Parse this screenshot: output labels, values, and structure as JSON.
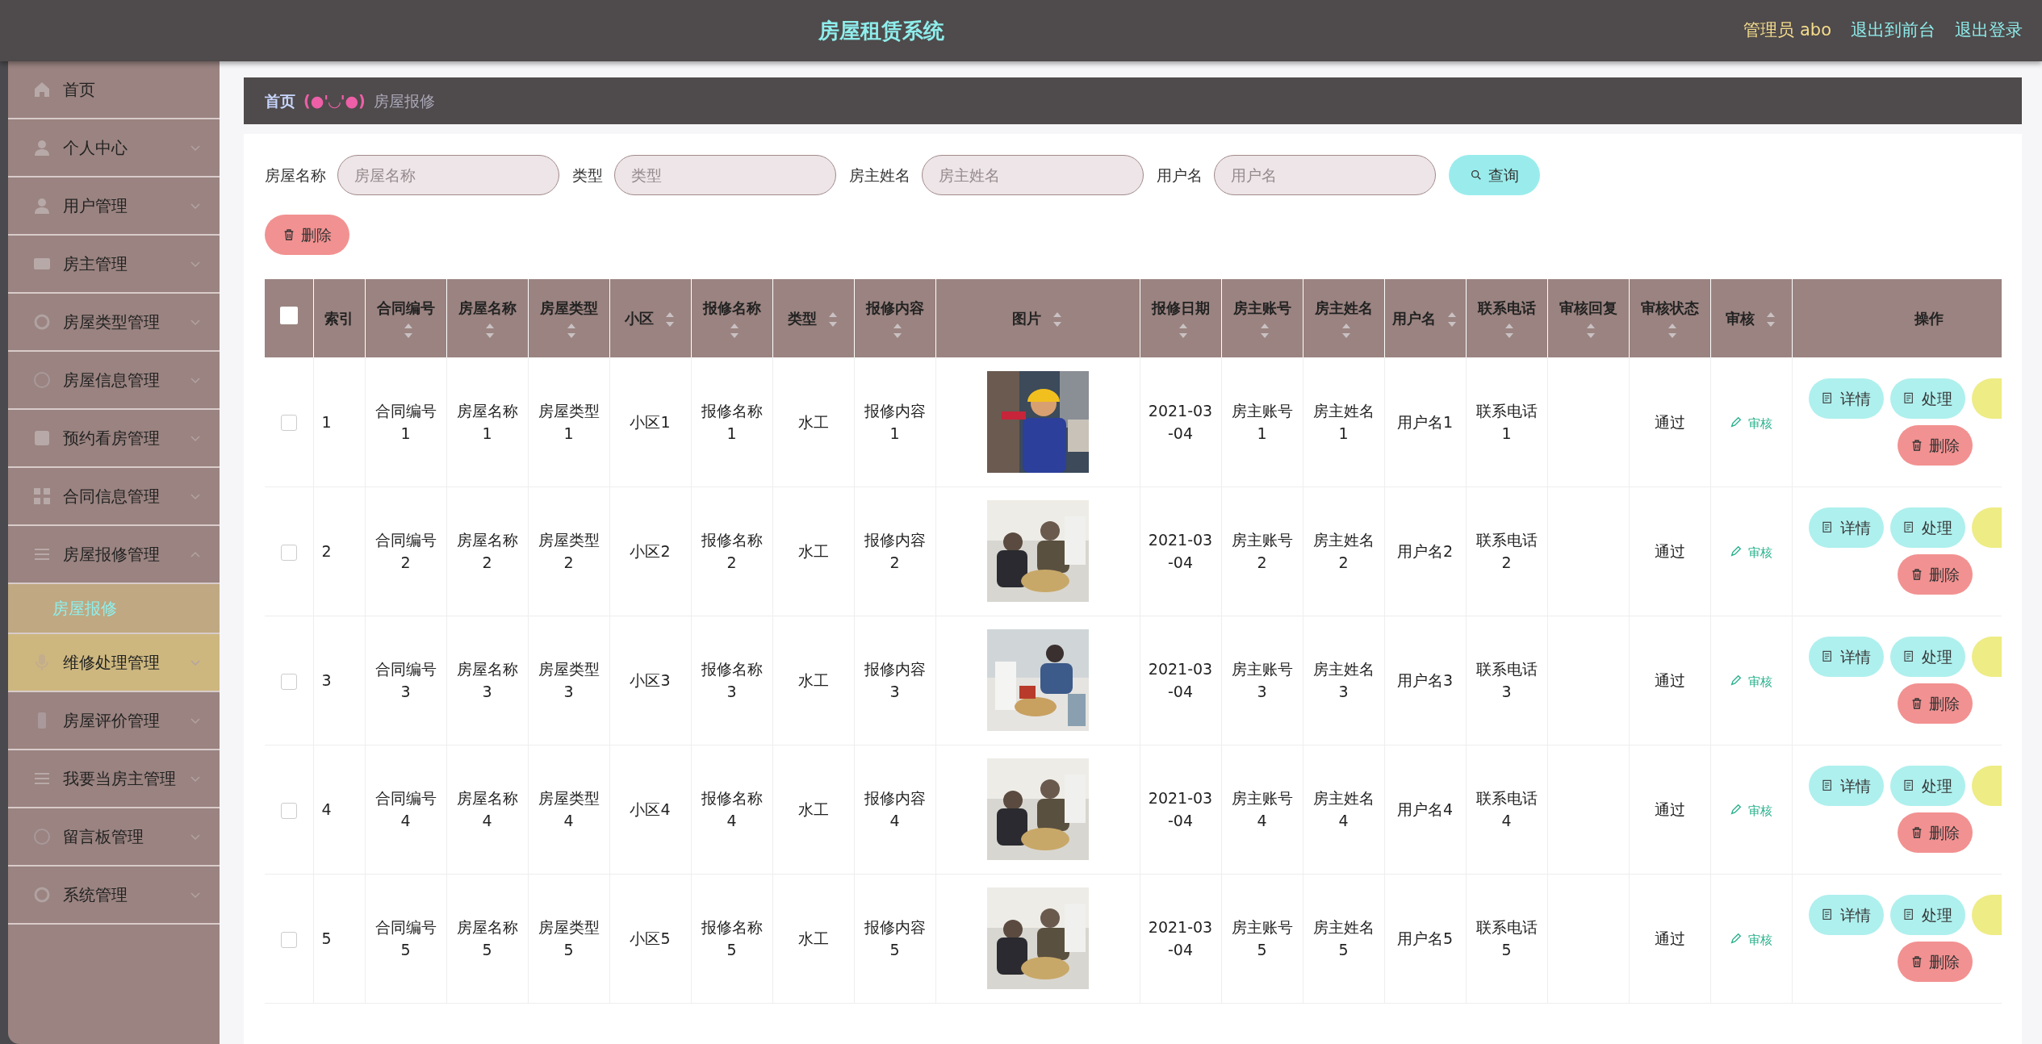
{
  "header": {
    "title": "房屋租赁系统",
    "user": "管理员 abo",
    "links": [
      "退出到前台",
      "退出登录"
    ]
  },
  "sidebar": {
    "items": [
      {
        "label": "首页",
        "has_children": false,
        "highlighted": false
      },
      {
        "label": "个人中心",
        "has_children": true,
        "expanded": false,
        "highlighted": false
      },
      {
        "label": "用户管理",
        "has_children": true,
        "expanded": false,
        "highlighted": false
      },
      {
        "label": "房主管理",
        "has_children": true,
        "expanded": false,
        "highlighted": false
      },
      {
        "label": "房屋类型管理",
        "has_children": true,
        "expanded": false,
        "highlighted": false
      },
      {
        "label": "房屋信息管理",
        "has_children": true,
        "expanded": false,
        "highlighted": false
      },
      {
        "label": "预约看房管理",
        "has_children": true,
        "expanded": false,
        "highlighted": false
      },
      {
        "label": "合同信息管理",
        "has_children": true,
        "expanded": false,
        "highlighted": false
      },
      {
        "label": "房屋报修管理",
        "has_children": true,
        "expanded": true,
        "highlighted": false,
        "children": [
          {
            "label": "房屋报修",
            "selected": true
          }
        ]
      },
      {
        "label": "维修处理管理",
        "has_children": true,
        "expanded": false,
        "highlighted": true
      },
      {
        "label": "房屋评价管理",
        "has_children": true,
        "expanded": false,
        "highlighted": false
      },
      {
        "label": "我要当房主管理",
        "has_children": true,
        "expanded": false,
        "highlighted": false
      },
      {
        "label": "留言板管理",
        "has_children": true,
        "expanded": false,
        "highlighted": false
      },
      {
        "label": "系统管理",
        "has_children": true,
        "expanded": false,
        "highlighted": false
      }
    ]
  },
  "breadcrumb": {
    "home": "首页",
    "separator": "(●'◡'●)",
    "current": "房屋报修"
  },
  "search": {
    "fields": [
      {
        "label": "房屋名称",
        "placeholder": "房屋名称"
      },
      {
        "label": "类型",
        "placeholder": "类型"
      },
      {
        "label": "房主姓名",
        "placeholder": "房主姓名"
      },
      {
        "label": "用户名",
        "placeholder": "用户名"
      }
    ],
    "button": "查询"
  },
  "delete_button": "删除",
  "table": {
    "select_all_checked": false,
    "columns": [
      {
        "label": "索引",
        "sortable": false
      },
      {
        "label": "合同编号",
        "sortable": true
      },
      {
        "label": "房屋名称",
        "sortable": true
      },
      {
        "label": "房屋类型",
        "sortable": true
      },
      {
        "label": "小区",
        "sortable": true
      },
      {
        "label": "报修名称",
        "sortable": true
      },
      {
        "label": "类型",
        "sortable": true
      },
      {
        "label": "报修内容",
        "sortable": true
      },
      {
        "label": "图片",
        "sortable": true
      },
      {
        "label": "报修日期",
        "sortable": true
      },
      {
        "label": "房主账号",
        "sortable": true
      },
      {
        "label": "房主姓名",
        "sortable": true
      },
      {
        "label": "用户名",
        "sortable": true
      },
      {
        "label": "联系电话",
        "sortable": true
      },
      {
        "label": "审核回复",
        "sortable": true
      },
      {
        "label": "审核状态",
        "sortable": true
      },
      {
        "label": "审核",
        "sortable": true
      },
      {
        "label": "操作",
        "sortable": false
      }
    ],
    "rows": [
      {
        "checked": false,
        "cells": [
          "1",
          "合同编号1",
          "房屋名称1",
          "房屋类型1",
          "小区1",
          "报修名称1",
          "水工",
          "报修内容1",
          "",
          "2021-03-04",
          "房主账号1",
          "房主姓名1",
          "用户名1",
          "联系电话1",
          "",
          "通过"
        ],
        "review": "审核",
        "actions": [
          "详情",
          "处理",
          "删除"
        ]
      },
      {
        "checked": false,
        "cells": [
          "2",
          "合同编号2",
          "房屋名称2",
          "房屋类型2",
          "小区2",
          "报修名称2",
          "水工",
          "报修内容2",
          "",
          "2021-03-04",
          "房主账号2",
          "房主姓名2",
          "用户名2",
          "联系电话2",
          "",
          "通过"
        ],
        "review": "审核",
        "actions": [
          "详情",
          "处理",
          "删除"
        ]
      },
      {
        "checked": false,
        "cells": [
          "3",
          "合同编号3",
          "房屋名称3",
          "房屋类型3",
          "小区3",
          "报修名称3",
          "水工",
          "报修内容3",
          "",
          "2021-03-04",
          "房主账号3",
          "房主姓名3",
          "用户名3",
          "联系电话3",
          "",
          "通过"
        ],
        "review": "审核",
        "actions": [
          "详情",
          "处理",
          "删除"
        ]
      },
      {
        "checked": false,
        "cells": [
          "4",
          "合同编号4",
          "房屋名称4",
          "房屋类型4",
          "小区4",
          "报修名称4",
          "水工",
          "报修内容4",
          "",
          "2021-03-04",
          "房主账号4",
          "房主姓名4",
          "用户名4",
          "联系电话4",
          "",
          "通过"
        ],
        "review": "审核",
        "actions": [
          "详情",
          "处理",
          "删除"
        ]
      },
      {
        "checked": false,
        "cells": [
          "5",
          "合同编号5",
          "房屋名称5",
          "房屋类型5",
          "小区5",
          "报修名称5",
          "水工",
          "报修内容5",
          "",
          "2021-03-04",
          "房主账号5",
          "房主姓名5",
          "用户名5",
          "联系电话5",
          "",
          "通过"
        ],
        "review": "审核",
        "actions": [
          "详情",
          "处理",
          "删除"
        ]
      }
    ]
  }
}
